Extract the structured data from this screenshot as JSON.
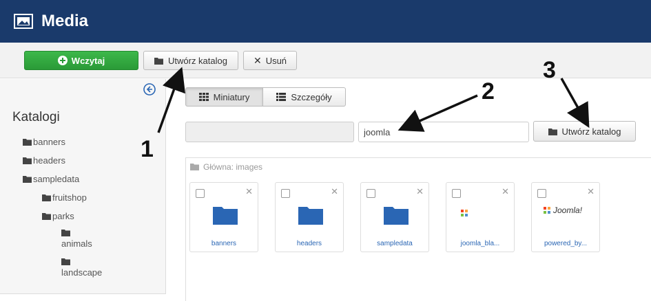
{
  "header": {
    "title": "Media"
  },
  "toolbar": {
    "upload_label": "Wczytaj",
    "create_folder_label": "Utwórz katalog",
    "delete_label": "Usuń"
  },
  "sidebar": {
    "title": "Katalogi",
    "tree": [
      {
        "label": "banners"
      },
      {
        "label": "headers"
      },
      {
        "label": "sampledata"
      },
      {
        "label": "fruitshop"
      },
      {
        "label": "parks"
      },
      {
        "label": "animals"
      },
      {
        "label": "landscape"
      }
    ]
  },
  "view": {
    "thumbnails_label": "Miniatury",
    "details_label": "Szczegóły"
  },
  "create": {
    "folder_name_value": "joomla",
    "button_label": "Utwórz katalog"
  },
  "breadcrumb": {
    "label": "Główna: images"
  },
  "items": [
    {
      "name": "banners"
    },
    {
      "name": "headers"
    },
    {
      "name": "sampledata"
    },
    {
      "name": "joomla_bla..."
    },
    {
      "name": "powered_by..."
    }
  ],
  "brand_text": "Joomla!",
  "annotations": {
    "n1": "1",
    "n2": "2",
    "n3": "3"
  },
  "colors": {
    "header_bg": "#1a3a6b",
    "upload_green": "#2a9a37",
    "folder_blue": "#2a66b4"
  }
}
